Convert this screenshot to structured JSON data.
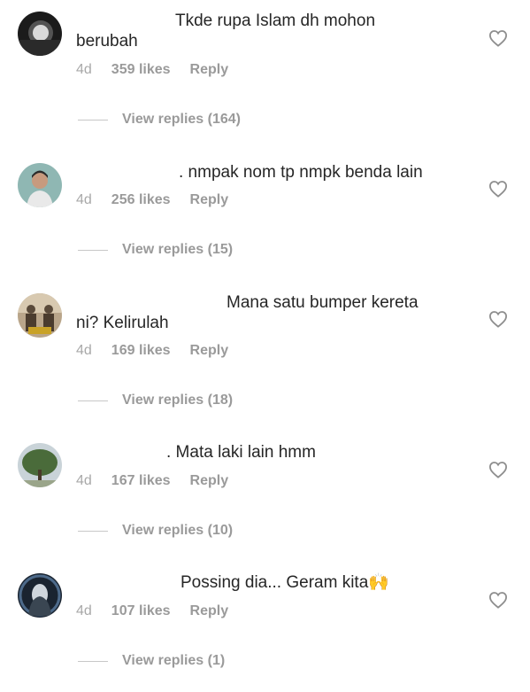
{
  "comments": [
    {
      "text_line1": "Tkde rupa Islam dh mohon",
      "text_line2": "berubah",
      "age": "4d",
      "likes": "359 likes",
      "reply": "Reply",
      "view_replies": "View replies (164)"
    },
    {
      "text_line1": ". nmpak nom tp nmpk benda lain",
      "text_line2": "",
      "age": "4d",
      "likes": "256 likes",
      "reply": "Reply",
      "view_replies": "View replies (15)"
    },
    {
      "text_line1": "Mana satu bumper kereta",
      "text_line2": "ni?  Kelirulah",
      "age": "4d",
      "likes": "169 likes",
      "reply": "Reply",
      "view_replies": "View replies (18)"
    },
    {
      "text_line1": ". Mata laki lain hmm",
      "text_line2": "",
      "age": "4d",
      "likes": "167 likes",
      "reply": "Reply",
      "view_replies": "View replies (10)"
    },
    {
      "text_line1": "Possing dia... Geram kita🙌",
      "text_line2": "",
      "age": "4d",
      "likes": "107 likes",
      "reply": "Reply",
      "view_replies": "View replies (1)"
    }
  ],
  "icons": {
    "like": "heart-outline-icon"
  },
  "colors": {
    "text": "#262626",
    "secondary": "#a8a8a8",
    "divider": "#c7c7c7"
  }
}
